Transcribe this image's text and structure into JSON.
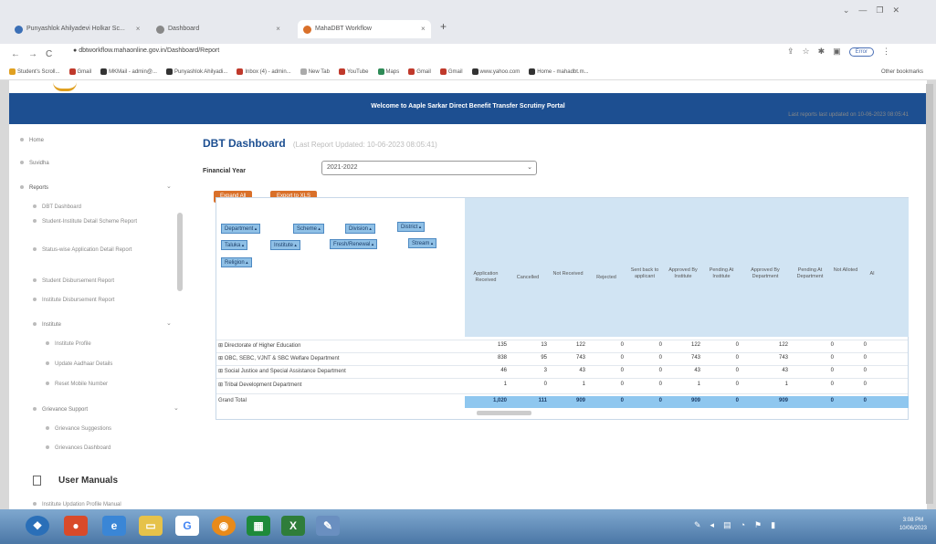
{
  "browser": {
    "tabs": [
      {
        "label": "Punyashlok Ahilyadevi Holkar Sc..."
      },
      {
        "label": "Dashboard"
      },
      {
        "label": "MahaDBT Workflow"
      }
    ],
    "url": "dbtworkflow.mahaonline.gov.in/Dashboard/Report",
    "profile_label": "Error",
    "bookmarks": [
      "Student's Scroll...",
      "Gmail",
      "MKMail - admin@...",
      "Punyashlok Ahilyadi...",
      "Inbox (4) - admin...",
      "New Tab",
      "YouTube",
      "Maps",
      "Gmail",
      "Gmail",
      "www.yahoo.com",
      "Home - mahadbt.m..."
    ],
    "other_bookmarks": "Other bookmarks"
  },
  "header": {
    "banner_title": "Welcome to Aaple Sarkar Direct Benefit Transfer Scrutiny Portal",
    "updated_note": "Last reports last updated on 10-06-2023 08:05:41"
  },
  "sidebar": {
    "home": "Home",
    "suvidha": "Suvidha",
    "reports": "Reports",
    "report_items": [
      "DBT Dashboard",
      "Student-Institute Detail Scheme Report",
      "Status-wise Application Detail Report",
      "Student Disbursement Report",
      "Institute Disbursement Report"
    ],
    "institute": "Institute",
    "institute_items": [
      "Institute Profile",
      "Update Aadhaar Details",
      "Reset Mobile Number"
    ],
    "grievance": "Grievance Support",
    "grievance_items": [
      "Grievance Suggestions",
      "Grievances Dashboard"
    ],
    "user_manuals": "User Manuals",
    "manual_item": "Institute Updation Profile Manual"
  },
  "main": {
    "title": "DBT Dashboard",
    "last_updated": "(Last Report Updated: 10-06-2023 08:05:41)",
    "fy_label": "Financial Year",
    "fy_value": "2021-2022",
    "expand_all": "Expand All",
    "export_xls": "Export to XLS"
  },
  "pivot": {
    "fields": [
      "Department",
      "Scheme",
      "Division",
      "District",
      "Taluka",
      "Institute",
      "Fresh/Renewal",
      "Stream",
      "Religion"
    ],
    "columns": [
      "Application Received",
      "Cancelled",
      "Not Received",
      "Rejected",
      "Sent back to applicant",
      "Approved By Institute",
      "Pending At Institute",
      "Approved By Department",
      "Pending At Department",
      "Not Alloted",
      "Al"
    ],
    "rows": [
      {
        "label": "Directorate of Higher Education",
        "values": [
          "135",
          "13",
          "122",
          "0",
          "0",
          "122",
          "0",
          "122",
          "0",
          "0"
        ]
      },
      {
        "label": "OBC, SEBC, VJNT & SBC Welfare Department",
        "values": [
          "838",
          "95",
          "743",
          "0",
          "0",
          "743",
          "0",
          "743",
          "0",
          "0"
        ]
      },
      {
        "label": "Social Justice and Special Assistance Department",
        "values": [
          "46",
          "3",
          "43",
          "0",
          "0",
          "43",
          "0",
          "43",
          "0",
          "0"
        ]
      },
      {
        "label": "Tribal Development Department",
        "values": [
          "1",
          "0",
          "1",
          "0",
          "0",
          "1",
          "0",
          "1",
          "0",
          "0"
        ]
      }
    ],
    "grand_total": {
      "label": "Grand Total",
      "values": [
        "1,020",
        "111",
        "909",
        "0",
        "0",
        "909",
        "0",
        "909",
        "0",
        "0"
      ]
    }
  },
  "taskbar": {
    "clock_time": "3:08 PM",
    "clock_date": "10/06/2023"
  }
}
